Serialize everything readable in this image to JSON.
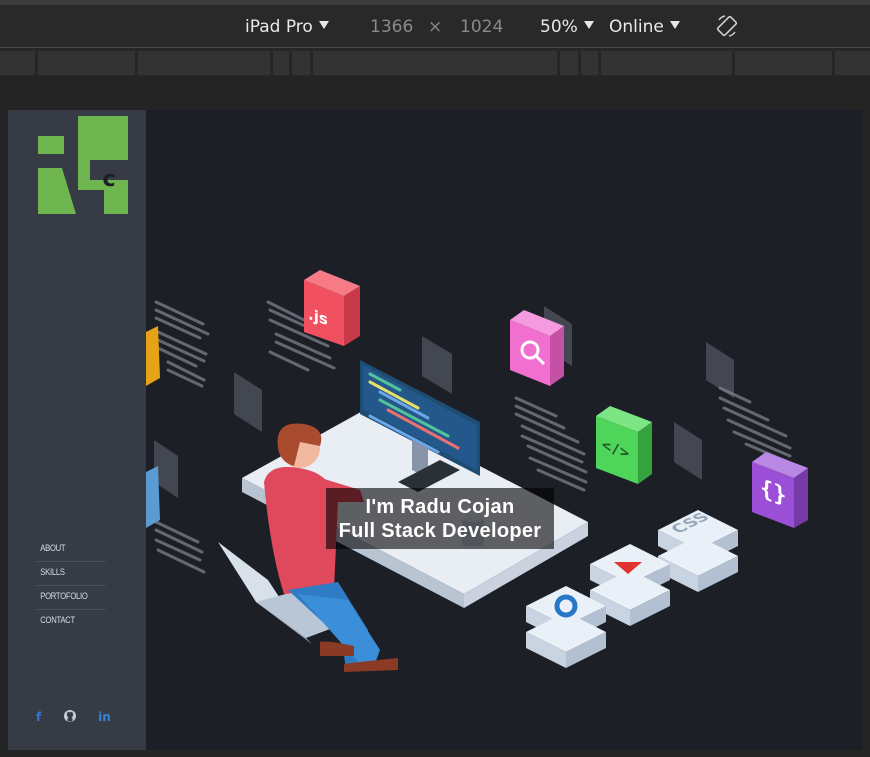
{
  "toolbar": {
    "device": "iPad Pro",
    "width": "1366",
    "times": "×",
    "height": "1024",
    "zoom": "50%",
    "network": "Online",
    "rotate_icon": "rotate-icon"
  },
  "sidebar": {
    "logo_letters": "Rc",
    "nav": [
      "ABOUT",
      "SKILLS",
      "PORTOFOLIO",
      "CONTACT"
    ],
    "social": {
      "facebook": "f",
      "linkedin": "in"
    }
  },
  "hero": {
    "line1": "I'm Radu Cojan",
    "line2": "Full Stack Developer"
  },
  "illustration": {
    "js_label": ".js",
    "css_label": "CSS",
    "brace_label": "{}",
    "code_label": "</>"
  },
  "colors": {
    "accent_green": "#6fb54f",
    "background": "#1c1f26",
    "sidebar": "#363b45"
  }
}
